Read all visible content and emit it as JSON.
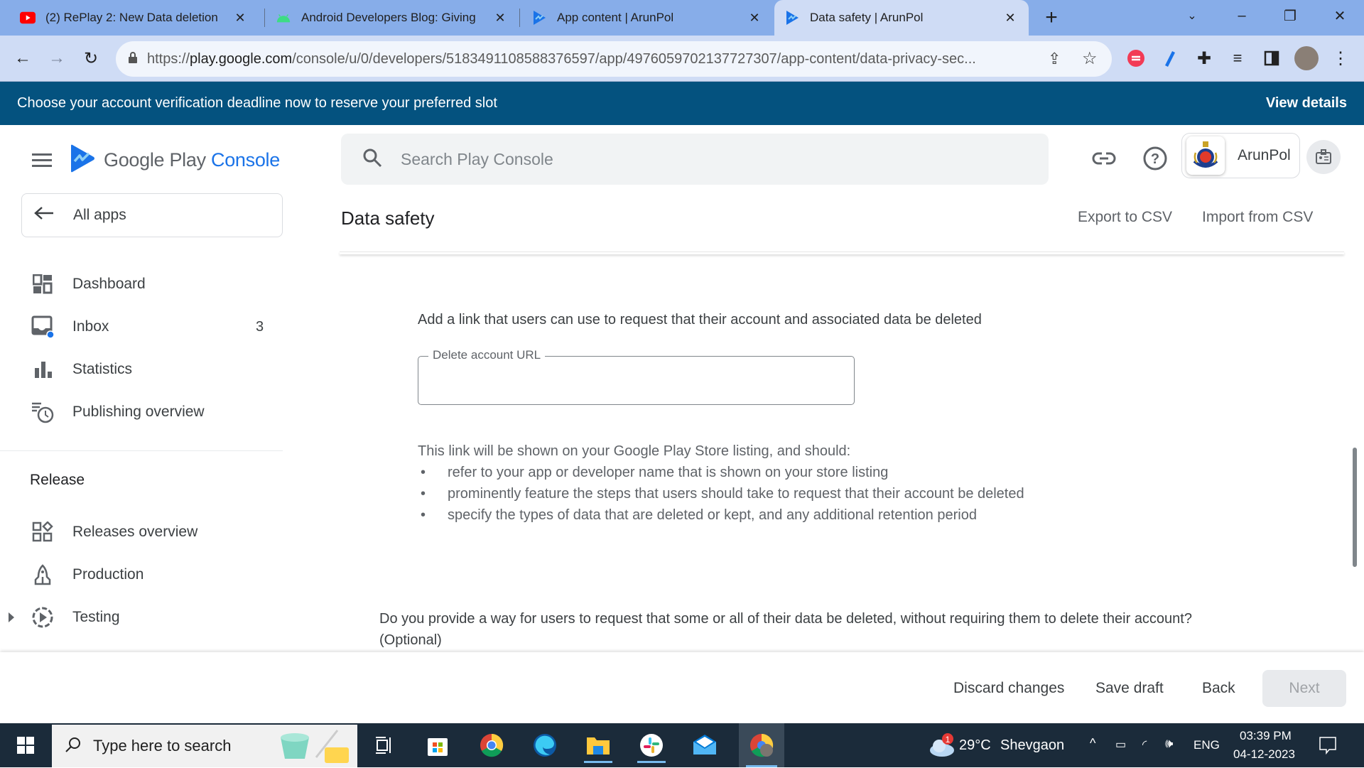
{
  "browser": {
    "tabs": [
      {
        "title": "(2) RePlay 2: New Data deletion",
        "icon": "youtube-icon",
        "active": false
      },
      {
        "title": "Android Developers Blog: Giving",
        "icon": "android-icon",
        "active": false
      },
      {
        "title": "App content | ArunPol",
        "icon": "play-console-icon",
        "active": false
      },
      {
        "title": "Data safety | ArunPol",
        "icon": "play-console-icon",
        "active": true
      }
    ],
    "new_tab_label": "+",
    "url_prefix": "https://",
    "url_host": "play.google.com",
    "url_path": "/console/u/0/developers/5183491108588376597/app/4976059702137727307/app-content/data-privacy-sec..."
  },
  "banner": {
    "message": "Choose your account verification deadline now to reserve your preferred slot",
    "action": "View details"
  },
  "header": {
    "logo_text_main": "Google Play ",
    "logo_text_accent": "Console",
    "search_placeholder": "Search Play Console",
    "app_name": "ArunPol"
  },
  "sidebar": {
    "back_label": "All apps",
    "items": [
      {
        "label": "Dashboard",
        "icon": "dashboard-icon"
      },
      {
        "label": "Inbox",
        "icon": "inbox-icon",
        "count": "3"
      },
      {
        "label": "Statistics",
        "icon": "bar-chart-icon"
      },
      {
        "label": "Publishing overview",
        "icon": "publishing-clock-icon"
      }
    ],
    "section_release": "Release",
    "release_items": [
      {
        "label": "Releases overview",
        "icon": "releases-overview-icon"
      },
      {
        "label": "Production",
        "icon": "rocket-icon"
      },
      {
        "label": "Testing",
        "icon": "testing-play-icon",
        "expandable": true
      }
    ]
  },
  "page": {
    "title": "Data safety",
    "export_label": "Export to CSV",
    "import_label": "Import from CSV",
    "delete_link_prompt": "Add a link that users can use to request that their account and associated data be deleted",
    "url_field_label": "Delete account URL",
    "url_field_value": "",
    "info_intro": "This link will be shown on your Google Play Store listing, and should:",
    "info_bullets": [
      "refer to your app or developer name that is shown on your store listing",
      "prominently feature the steps that users should take to request that their account be deleted",
      "specify the types of data that are deleted or kept, and any additional retention period"
    ],
    "partial_deletion_question": "Do you provide a way for users to request that some or all of their data be deleted, without requiring them to delete their account?",
    "partial_deletion_optional": "(Optional)"
  },
  "actions": {
    "discard": "Discard changes",
    "save_draft": "Save draft",
    "back": "Back",
    "next": "Next"
  },
  "taskbar": {
    "search_placeholder": "Type here to search",
    "weather_temp": "29°C",
    "weather_location": "Shevgaon",
    "weather_badge": "1",
    "language": "ENG",
    "time": "03:39 PM",
    "date": "04-12-2023"
  },
  "colors": {
    "banner_bg": "#04527f",
    "accent": "#1a73e8",
    "tabstrip": "#87ade9",
    "taskbar": "#1b2b3a"
  }
}
